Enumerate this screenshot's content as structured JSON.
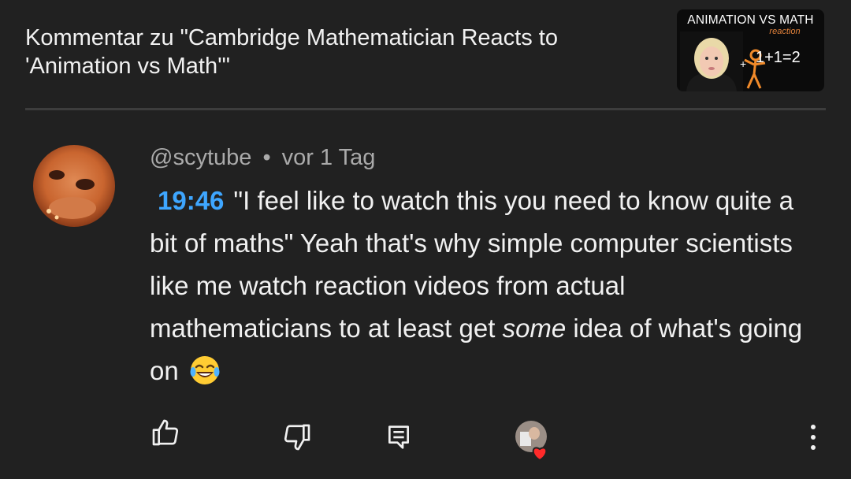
{
  "header": {
    "title": "Kommentar zu \"Cambridge Mathematician Reacts to 'Animation vs Math'\"",
    "thumbnail": {
      "title": "ANIMATION VS MATH",
      "subtitle": "reaction",
      "equation": "1+1=2"
    }
  },
  "comment": {
    "author": "@scytube",
    "separator": "•",
    "time_ago": "vor 1 Tag",
    "timestamp": "19:46",
    "text_before_emphasis": "\"I feel like to watch this you need to know quite a bit of maths\" Yeah that's why simple computer scientists like me watch reaction videos from actual mathematicians to at least get ",
    "emphasis": "some",
    "text_after_emphasis": " idea of what's going on",
    "emoji": "face-with-tears-of-joy"
  },
  "actions": {
    "like_icon": "thumbs-up-icon",
    "dislike_icon": "thumbs-down-icon",
    "reply_icon": "reply-icon",
    "creator_heart_icon": "heart-icon",
    "more_icon": "more-vert-icon"
  },
  "colors": {
    "background": "#212121",
    "text": "#f1f1f1",
    "secondary_text": "#aaaaaa",
    "timestamp_link": "#3ea6ff",
    "heart": "#ff2a2a",
    "thumbnail_accent": "#e0803a"
  }
}
